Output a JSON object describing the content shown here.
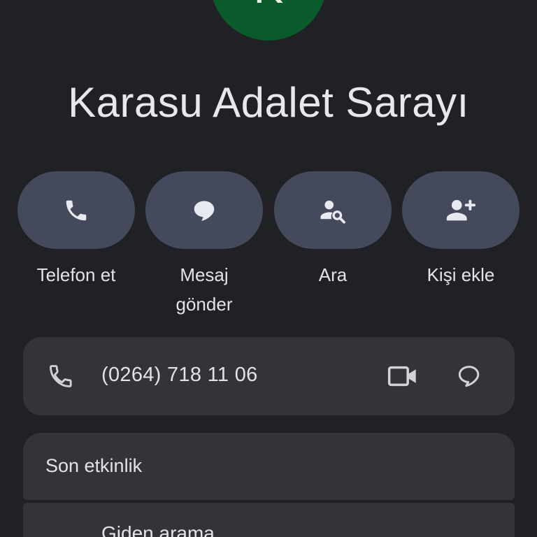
{
  "contact": {
    "avatar_letter": "K",
    "name": "Karasu Adalet Sarayı",
    "avatar_color": "#0b5a2b"
  },
  "actions": [
    {
      "label": "Telefon et",
      "icon": "phone-icon"
    },
    {
      "label": "Mesaj gönder",
      "icon": "message-icon"
    },
    {
      "label": "Ara",
      "icon": "person-search-icon"
    },
    {
      "label": "Kişi ekle",
      "icon": "person-add-icon"
    }
  ],
  "phone": {
    "number": "(0264) 718 11 06",
    "icons": [
      "phone-icon",
      "video-call-icon",
      "message-outline-icon"
    ]
  },
  "recent_activity": {
    "title": "Son etkinlik",
    "items": [
      {
        "label": "Giden arama"
      }
    ]
  },
  "colors": {
    "background": "#202124",
    "action_pill": "#444a5c",
    "card": "#333438",
    "text": "#e3e3e6"
  }
}
